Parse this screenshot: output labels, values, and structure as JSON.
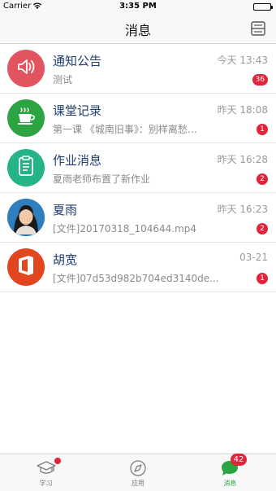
{
  "status": {
    "carrier": "Carrier",
    "time": "3:35 PM"
  },
  "header": {
    "title": "消息"
  },
  "messages": [
    {
      "name": "通知公告",
      "time": "今天 13:43",
      "preview": "测试",
      "badge": "36",
      "avatar_color": "#e25560",
      "icon": "speaker-icon"
    },
    {
      "name": "课堂记录",
      "time": "昨天 18:08",
      "preview": "第一课 《城南旧事》：别样离愁…",
      "badge": "1",
      "avatar_color": "#2ba441",
      "icon": "coffee-cup-icon"
    },
    {
      "name": "作业消息",
      "time": "昨天 16:28",
      "preview": "夏雨老师布置了新作业",
      "badge": "2",
      "avatar_color": "#25b487",
      "icon": "clipboard-icon"
    },
    {
      "name": "夏雨",
      "time": "昨天 16:23",
      "preview": "[文件]20170318_104644.mp4",
      "badge": "2",
      "avatar_color": "#1d6aa8",
      "icon": "user-photo"
    },
    {
      "name": "胡宽",
      "time": "03-21",
      "preview": "[文件]07d53d982b704ed3140de...",
      "badge": "1",
      "avatar_color": "#e2461e",
      "icon": "office-icon"
    }
  ],
  "tabs": [
    {
      "label": "学习",
      "icon": "graduation-cap-icon",
      "dot": true
    },
    {
      "label": "应用",
      "icon": "compass-icon"
    },
    {
      "label": "消息",
      "icon": "chat-bubble-icon",
      "badge": "42",
      "active": true
    }
  ],
  "colors": {
    "badge": "#e2233a",
    "accent": "#2ba441",
    "title_text": "#1f3e6e"
  }
}
